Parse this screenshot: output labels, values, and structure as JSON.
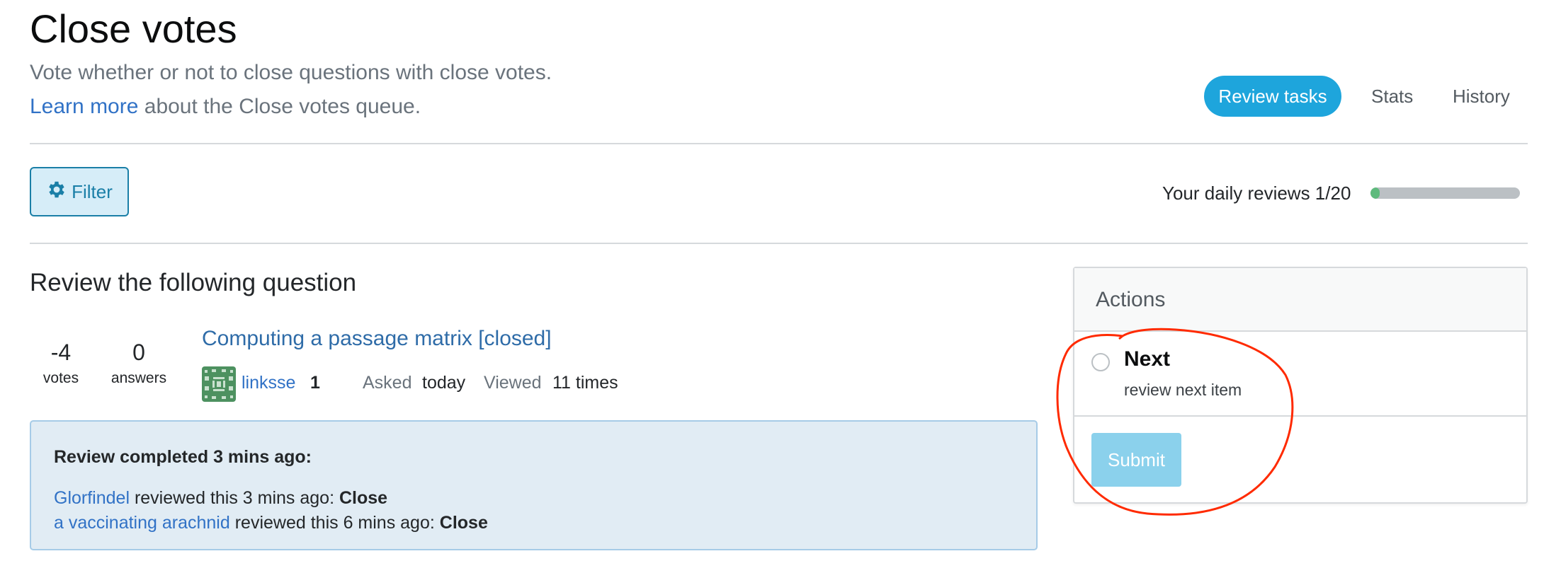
{
  "header": {
    "title": "Close votes",
    "subtitle": "Vote whether or not to close questions with close votes.",
    "learn_link": "Learn more",
    "learn_rest": " about the Close votes queue."
  },
  "nav": {
    "tabs": [
      {
        "label": "Review tasks",
        "active": true
      },
      {
        "label": "Stats",
        "active": false
      },
      {
        "label": "History",
        "active": false
      }
    ]
  },
  "toolbar": {
    "filter_label": "Filter",
    "filter_icon": "gear-icon",
    "daily_label": "Your daily reviews 1/20",
    "daily_done": 1,
    "daily_total": 20
  },
  "review": {
    "heading": "Review the following question",
    "votes": "-4",
    "votes_label": "votes",
    "answers": "0",
    "answers_label": "answers",
    "question_title": "Computing a passage matrix [closed]",
    "author": "linksse",
    "author_rep": "1",
    "asked_label": "Asked",
    "asked_value": "today",
    "viewed_label": "Viewed",
    "viewed_value": "11 times"
  },
  "completed": {
    "heading": "Review completed 3 mins ago:",
    "entries": [
      {
        "user": "Glorfindel",
        "text": " reviewed this 3 mins ago: ",
        "action": "Close"
      },
      {
        "user": "a vaccinating arachnid",
        "text": " reviewed this 6 mins ago: ",
        "action": "Close"
      }
    ]
  },
  "actions": {
    "heading": "Actions",
    "options": [
      {
        "label": "Next",
        "description": "review next item",
        "selected": false
      }
    ],
    "submit_label": "Submit"
  },
  "colors": {
    "accent": "#1ea5dc",
    "link": "#3172c6",
    "progress": "#5eba7d",
    "annotation": "#ff2a00"
  }
}
